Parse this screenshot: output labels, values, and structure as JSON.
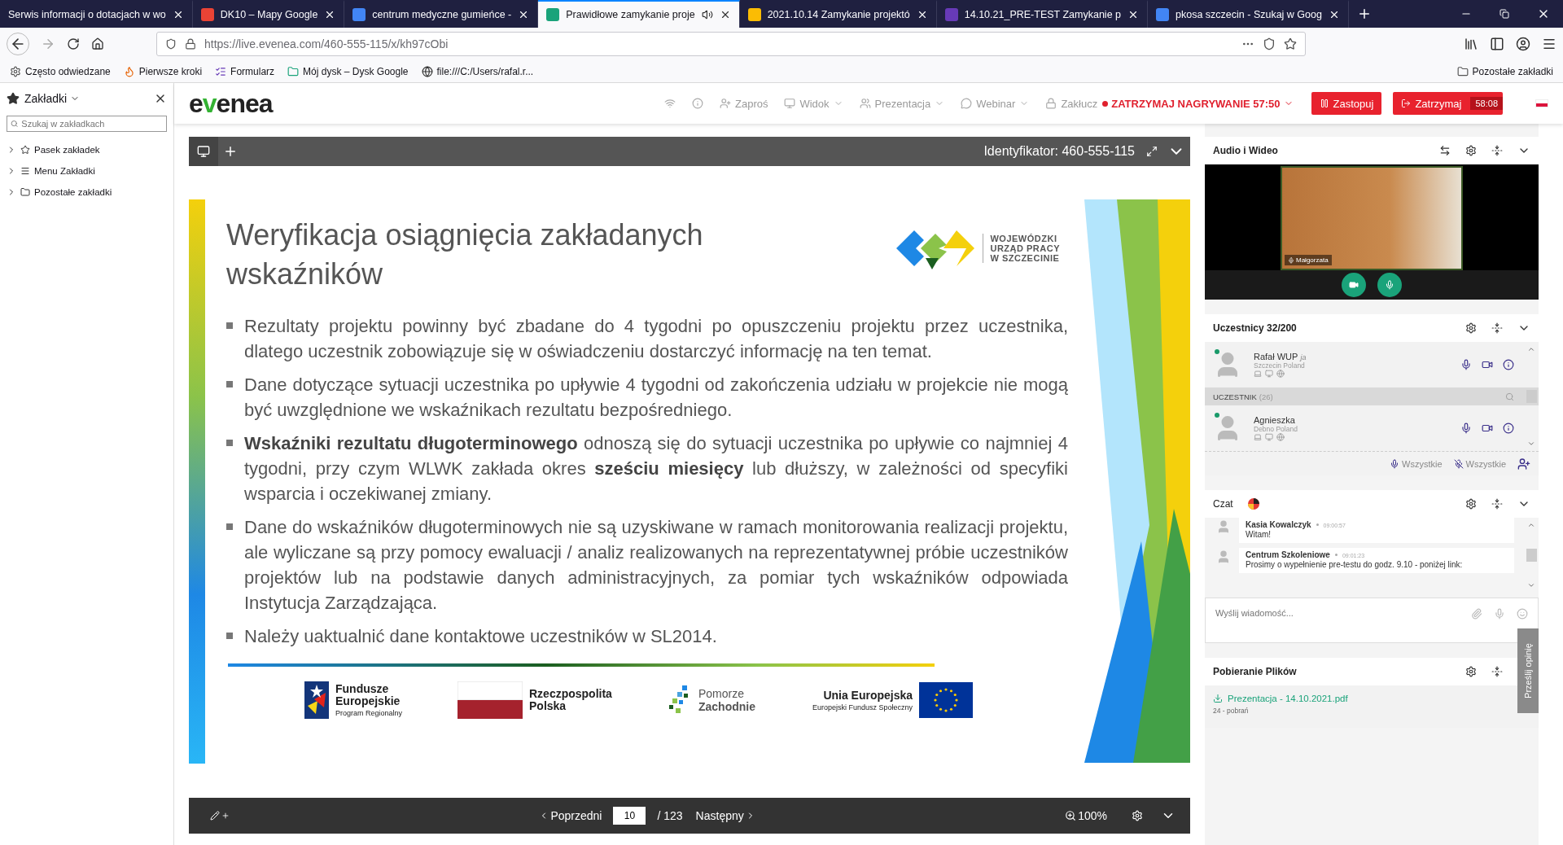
{
  "browser": {
    "tabs": [
      {
        "title": "Serwis informacji o dotacjach w wo",
        "selected": false,
        "audio": false
      },
      {
        "title": "DK10 – Mapy Google",
        "selected": false,
        "audio": false,
        "color": "#ea4335"
      },
      {
        "title": "centrum medyczne gumieńce -",
        "selected": false,
        "audio": false,
        "color": "#4285f4"
      },
      {
        "title": "Prawidłowe zamykanie proje",
        "selected": true,
        "audio": true,
        "color": "#1aa37a"
      },
      {
        "title": "2021.10.14 Zamykanie projektó",
        "selected": false,
        "audio": false,
        "color": "#fbbc04"
      },
      {
        "title": "14.10.21_PRE-TEST Zamykanie p",
        "selected": false,
        "audio": false,
        "color": "#673ab7"
      },
      {
        "title": "pkosa szczecin - Szukaj w Goog",
        "selected": false,
        "audio": false,
        "color": "#4285f4"
      }
    ],
    "url": "https://live.evenea.com/460-555-115/x/kh97cObi",
    "bookmarks": [
      "Często odwiedzane",
      "Pierwsze kroki",
      "Formularz",
      "Mój dysk – Dysk Google",
      "file:///C:/Users/rafal.r..."
    ],
    "other_bookmarks": "Pozostałe zakładki"
  },
  "sidebar": {
    "title": "Zakładki",
    "search": {
      "placeholder": "Szukaj w zakładkach"
    },
    "items": [
      {
        "label": "Pasek zakładek",
        "expanded": false
      },
      {
        "label": "Menu Zakładki",
        "expanded": false
      },
      {
        "label": "Pozostałe zakładki",
        "expanded": false
      }
    ]
  },
  "header": {
    "logo": "evenea",
    "menu": [
      {
        "label": "Zaproś",
        "dropdown": false
      },
      {
        "label": "Widok",
        "dropdown": true
      },
      {
        "label": "Prezentacja",
        "dropdown": true
      },
      {
        "label": "Webinar",
        "dropdown": true
      },
      {
        "label": "Zakłucz",
        "dropdown": false
      }
    ],
    "recording": "ZATRZYMAJ NAGRYWANIE 57:50",
    "pause_button": "Zastopuj",
    "stop_button": "Zatrzymaj",
    "timer": "58:08"
  },
  "presentation": {
    "identifier": "Identyfikator: 460-555-115",
    "slide": {
      "title": "Weryfikacja osiągnięcia zakładanych wskaźników",
      "institution": [
        "WOJEWÓDZKI",
        "URZĄD PRACY",
        "W SZCZECINIE"
      ],
      "bullets": [
        "Rezultaty projektu powinny być zbadane do 4 tygodni po opuszczeniu projektu przez uczestnika, dlatego uczestnik zobowiązuje się w oświadczeniu dostarczyć informację na ten temat.",
        "Dane dotyczące sytuacji uczestnika po upływie 4 tygodni od zakończenia udziału w projekcie nie mogą być uwzględnione we wskaźnikach rezultatu bezpośredniego.",
        "**Wskaźniki rezultatu długoterminowego** odnoszą się do sytuacji uczestnika po upływie co najmniej 4 tygodni, przy czym WLWK zakłada okres **sześciu miesięcy** lub dłuższy, w zależności od specyfiki wsparcia i oczekiwanej zmiany.",
        "Dane do wskaźników długoterminowych nie są uzyskiwane w ramach monitorowania realizacji projektu, ale wyliczane są przy pomocy ewaluacji / analiz realizowanych na reprezentatywnej próbie uczestników projektów lub na podstawie danych administracyjnych, za pomiar tych wskaźników odpowiada Instytucja Zarządzająca.",
        "Należy uaktualnić dane kontaktowe uczestników w SL2014."
      ],
      "logos": [
        {
          "kind": "fe",
          "title": "Fundusze Europejskie",
          "subtitle": "Program Regionalny"
        },
        {
          "kind": "rp",
          "title": "Rzeczpospolita Polska"
        },
        {
          "kind": "pz",
          "title": "Pomorze",
          "subtitle": "Zachodnie"
        },
        {
          "kind": "ue",
          "title": "Unia Europejska",
          "subtitle": "Europejski Fundusz Społeczny"
        }
      ]
    },
    "previous": "Poprzedni",
    "page": "10",
    "total": "/ 123",
    "next": "Następny",
    "zoom": "100%"
  },
  "audio_video": {
    "title": "Audio i Wideo",
    "speaker": "Małgorzata"
  },
  "participants": {
    "title": "Uczestnicy 32/200",
    "host": {
      "name": "Rafał WUP",
      "tag": "ja",
      "location": "Szczecin Poland",
      "online": true
    },
    "group": {
      "label": "UCZESTNIK",
      "count": "(26)"
    },
    "members": [
      {
        "name": "Agnieszka",
        "location": "Debno Poland",
        "online": true
      }
    ],
    "footer": [
      "Wszystkie",
      "Wszystkie"
    ]
  },
  "chat": {
    "title": "Czat",
    "messages": [
      {
        "author": "Kasia Kowalczyk",
        "time": "09:00:57",
        "text": "Witam!"
      },
      {
        "author": "Centrum Szkoleniowe",
        "time": "09:01:23",
        "text": "Prosimy o wypełnienie pre-testu do godz. 9.10 - poniżej link:"
      }
    ],
    "input": {
      "placeholder": "Wyślij wiadomość..."
    }
  },
  "files": {
    "title": "Pobieranie Plików",
    "items": [
      {
        "name": "Prezentacja - 14.10.2021.pdf",
        "downloads": "24 - pobrań"
      }
    ]
  },
  "feedback": "Prześlij opinię"
}
